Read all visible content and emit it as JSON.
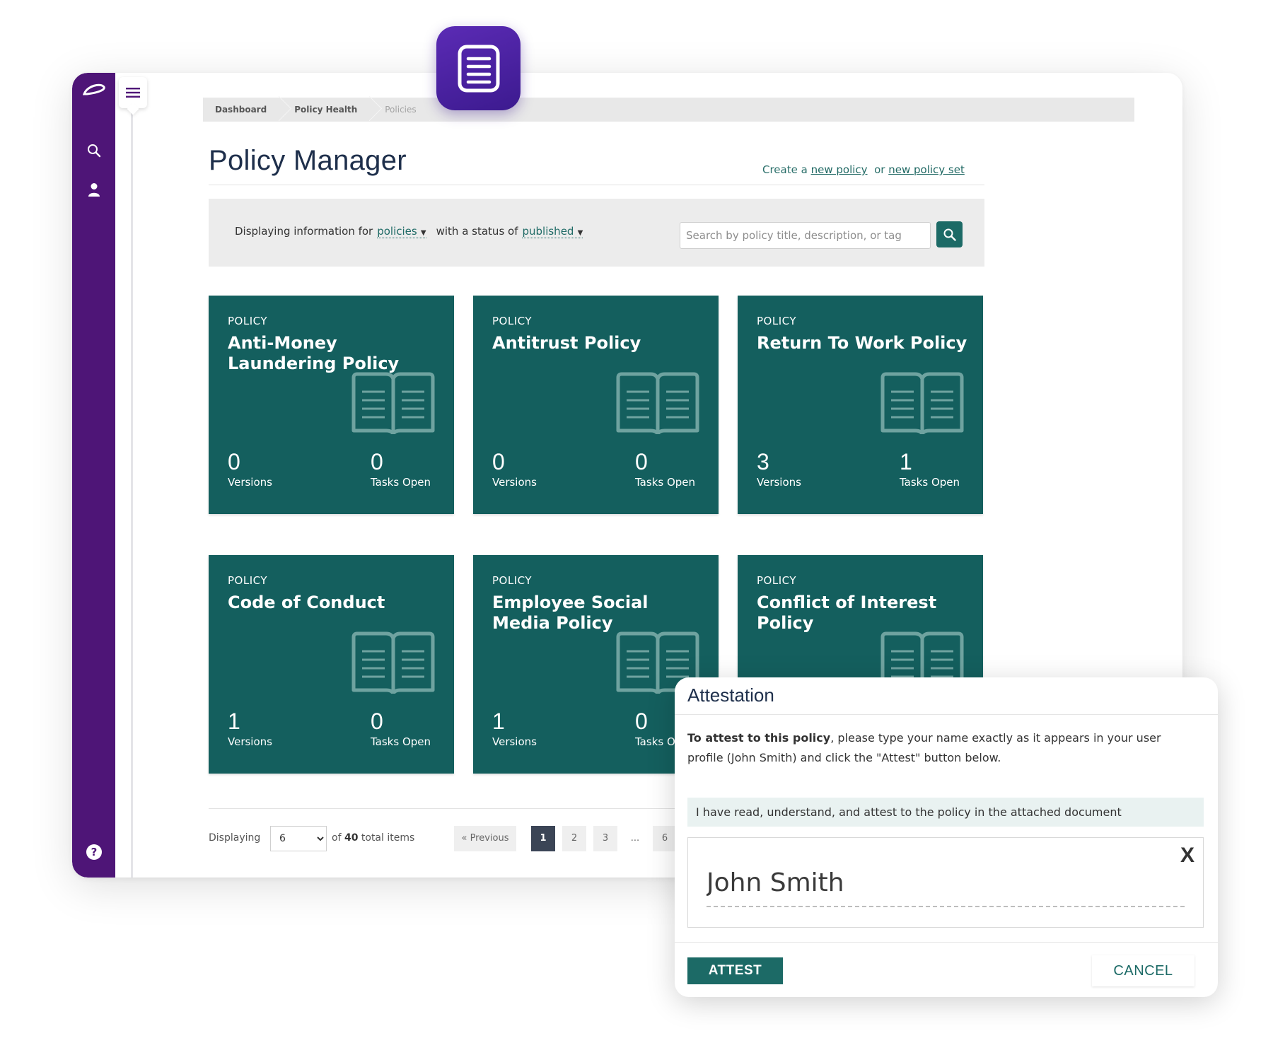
{
  "breadcrumb": [
    "Dashboard",
    "Policy Health",
    "Policies"
  ],
  "page_title": "Policy Manager",
  "create": {
    "prefix": "Create a",
    "new_policy": "new policy",
    "or": "or",
    "new_policy_set": "new policy set"
  },
  "filter": {
    "prefix": "Displaying information for",
    "type_value": "policies",
    "status_prefix": "with a status of",
    "status_value": "published",
    "search_placeholder": "Search by policy title, description, or tag"
  },
  "cards": [
    {
      "kind": "POLICY",
      "name": "Anti-Money Laundering Policy",
      "versions": "0",
      "versions_label": "Versions",
      "tasks": "0",
      "tasks_label": "Tasks Open"
    },
    {
      "kind": "POLICY",
      "name": "Antitrust Policy",
      "versions": "0",
      "versions_label": "Versions",
      "tasks": "0",
      "tasks_label": "Tasks Open"
    },
    {
      "kind": "POLICY",
      "name": "Return To Work Policy",
      "versions": "3",
      "versions_label": "Versions",
      "tasks": "1",
      "tasks_label": "Tasks Open"
    },
    {
      "kind": "POLICY",
      "name": "Code of Conduct",
      "versions": "1",
      "versions_label": "Versions",
      "tasks": "0",
      "tasks_label": "Tasks Open"
    },
    {
      "kind": "POLICY",
      "name": "Employee Social Media Policy",
      "versions": "1",
      "versions_label": "Versions",
      "tasks": "0",
      "tasks_label": "Tasks Open"
    },
    {
      "kind": "POLICY",
      "name": "Conflict of Interest Policy",
      "versions": "",
      "versions_label": "",
      "tasks": "",
      "tasks_label": ""
    }
  ],
  "pagination": {
    "displaying": "Displaying",
    "per_page": "6",
    "of": "of",
    "total": "40",
    "total_suffix": "total items",
    "previous": "« Previous",
    "pages": [
      "1",
      "2",
      "3",
      "...",
      "6"
    ],
    "current": "1"
  },
  "modal": {
    "title": "Attestation",
    "instr_bold": "To attest to this policy",
    "instr_rest": ", please type your name exactly as it appears in your user profile (John Smith) and click the \"Attest\" button below.",
    "statement": "I have read, understand, and attest to the policy in the attached document",
    "clear": "X",
    "signature": "John Smith",
    "attest_label": "ATTEST",
    "cancel_label": "CANCEL"
  },
  "icons": {
    "sidebar": [
      "logo-icon",
      "search-icon",
      "user-icon",
      "help-icon"
    ],
    "menu": "hamburger-icon",
    "app": "document-icon",
    "card": "open-book-icon"
  },
  "colors": {
    "sidebar": "#4e1577",
    "card": "#145f5e",
    "accent": "#1c6a66",
    "app_icon": "#4a22a0"
  }
}
